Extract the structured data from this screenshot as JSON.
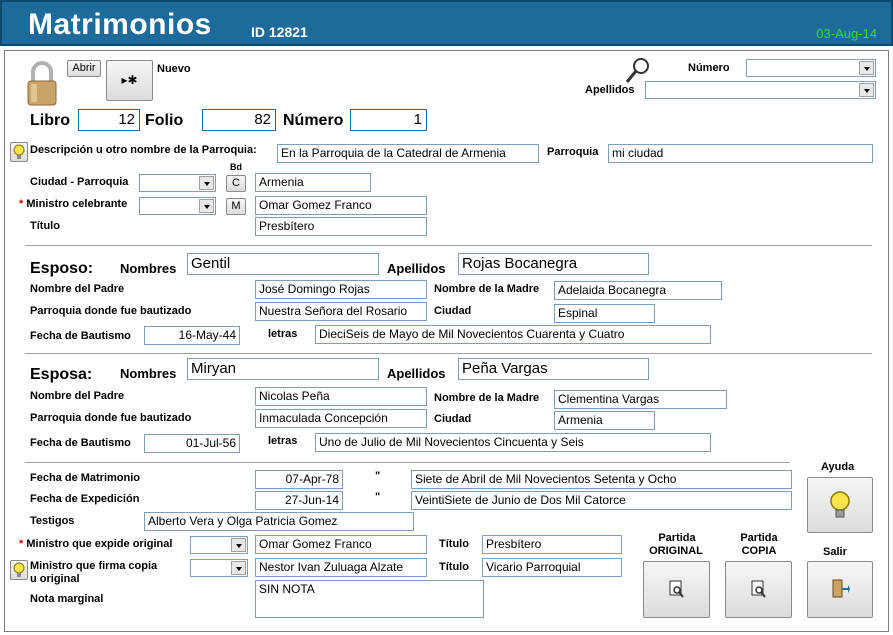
{
  "header": {
    "title": "Matrimonios",
    "id_label": "ID 12821",
    "date": "03-Aug-14"
  },
  "toolbar": {
    "open_label": "Abrir",
    "new_label": "Nuevo",
    "new_icon": "▸✱"
  },
  "search": {
    "numero_label": "Número",
    "apellidos_label": "Apellidos"
  },
  "registro": {
    "libro_label": "Libro",
    "libro": "12",
    "folio_label": "Folio",
    "folio": "82",
    "numero_label": "Número",
    "numero": "1"
  },
  "parroquia": {
    "desc_label": "Descripción u otro nombre de la Parroquia:",
    "desc_value": "En la Parroquia de la Catedral de Armenia",
    "parroquia_label": "Parroquia",
    "parroquia_value": "mi ciudad",
    "ciudad_label": "Ciudad - Parroquia",
    "bd_label": "Bd",
    "c_button": "C",
    "ciudad_value": "Armenia",
    "ministro_label": "Ministro celebrante",
    "m_button": "M",
    "ministro_value": "Omar Gomez Franco",
    "titulo_label": "Título",
    "titulo_value": "Presbítero"
  },
  "esposo": {
    "section_label": "Esposo:",
    "nombres_label": "Nombres",
    "nombres": "Gentil",
    "apellidos_label": "Apellidos",
    "apellidos": "Rojas Bocanegra",
    "padre_label": "Nombre del Padre",
    "padre": "José Domingo Rojas",
    "madre_label": "Nombre de la Madre",
    "madre": "Adelaida Bocanegra",
    "parroquia_label": "Parroquia donde fue bautizado",
    "parroquia": "Nuestra Señora del Rosario",
    "ciudad_label": "Ciudad",
    "ciudad": "Espinal",
    "fecha_label": "Fecha de Bautismo",
    "fecha": "16-May-44",
    "letras_label": "letras",
    "letras": "DieciSeis de Mayo de Mil Novecientos Cuarenta y Cuatro"
  },
  "esposa": {
    "section_label": "Esposa:",
    "nombres_label": "Nombres",
    "nombres": "Miryan",
    "apellidos_label": "Apellidos",
    "apellidos": "Peña Vargas",
    "padre_label": "Nombre del Padre",
    "padre": "Nicolas Peña",
    "madre_label": "Nombre de la Madre",
    "madre": "Clementina Vargas",
    "parroquia_label": "Parroquia donde fue bautizado",
    "parroquia": "Inmaculada Concepción",
    "ciudad_label": "Ciudad",
    "ciudad": "Armenia",
    "fecha_label": "Fecha de Bautismo",
    "fecha": "01-Jul-56",
    "letras_label": "letras",
    "letras": "Uno de Julio de Mil Novecientos Cincuenta y Seis"
  },
  "matrimonio": {
    "fecha_label": "Fecha de Matrimonio",
    "fecha": "07-Apr-78",
    "quote": "\"",
    "fecha_letras": "Siete de Abril de Mil Novecientos Setenta y Ocho",
    "expedicion_label": "Fecha de Expedición",
    "expedicion": "27-Jun-14",
    "expedicion_letras": "VeintiSiete de Junio de Dos Mil Catorce",
    "testigos_label": "Testigos",
    "testigos": "Alberto Vera y Olga Patricia Gomez",
    "ministro_expide_label": "Ministro que expide original",
    "ministro_expide": "Omar Gomez Franco",
    "titulo_label": "Título",
    "titulo_expide": "Presbítero",
    "ministro_firma_label_1": "Ministro que firma copia",
    "ministro_firma_label_2": "u original",
    "ministro_firma": "Nestor Ivan Zuluaga Alzate",
    "titulo_firma": "Vicario Parroquial",
    "nota_label": "Nota marginal",
    "nota": "SIN NOTA"
  },
  "actions": {
    "ayuda_label": "Ayuda",
    "partida_original_1": "Partida",
    "partida_original_2": "ORIGINAL",
    "partida_copia_1": "Partida",
    "partida_copia_2": "COPIA",
    "salir_label": "Salir"
  },
  "colors": {
    "title_bar": "#1d6b9a",
    "date_text": "#33dd33",
    "required_star": "#cc0000",
    "field_border": "#7f9db9"
  }
}
